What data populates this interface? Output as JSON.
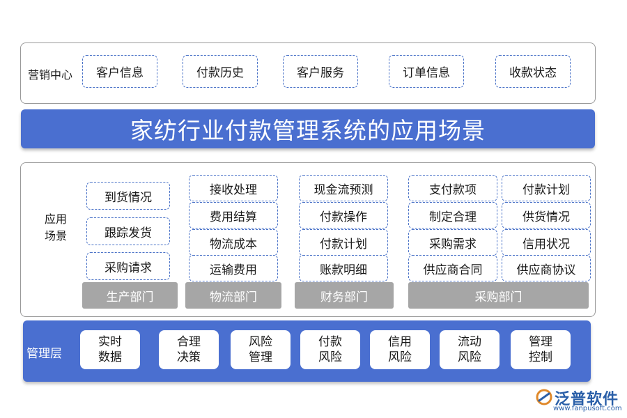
{
  "top": {
    "label": "营销中心",
    "items": [
      "客户信息",
      "付款历史",
      "客户服务",
      "订单信息",
      "收款状态"
    ]
  },
  "title": "家纺行业付款管理系统的应用场景",
  "scenes": {
    "label_line1": "应用",
    "label_line2": "场景",
    "production": {
      "dept": "生产部门",
      "items": [
        "到货情况",
        "跟踪发货",
        "采购请求"
      ]
    },
    "logistics": {
      "dept": "物流部门",
      "items": [
        "接收处理",
        "费用结算",
        "物流成本",
        "运输费用"
      ]
    },
    "finance": {
      "dept": "财务部门",
      "items": [
        "现金流预测",
        "付款操作",
        "付款计划",
        "账款明细"
      ]
    },
    "purchasing": {
      "dept": "采购部门",
      "items": [
        "支付款项",
        "付款计划",
        "制定合理",
        "供货情况",
        "采购需求",
        "信用状况",
        "供应商合同",
        "供应商协议"
      ]
    }
  },
  "management": {
    "label": "管理层",
    "items": [
      "实时数据",
      "合理决策",
      "风险管理",
      "付款风险",
      "信用风险",
      "流动风险",
      "管理控制"
    ]
  },
  "logo": {
    "text": "泛普软件",
    "url": "www.fanpusoft.com"
  },
  "colors": {
    "primary_blue": "#4a6fd0",
    "dept_gray": "#a6a6a6",
    "dash_border": "#4b73c8"
  }
}
